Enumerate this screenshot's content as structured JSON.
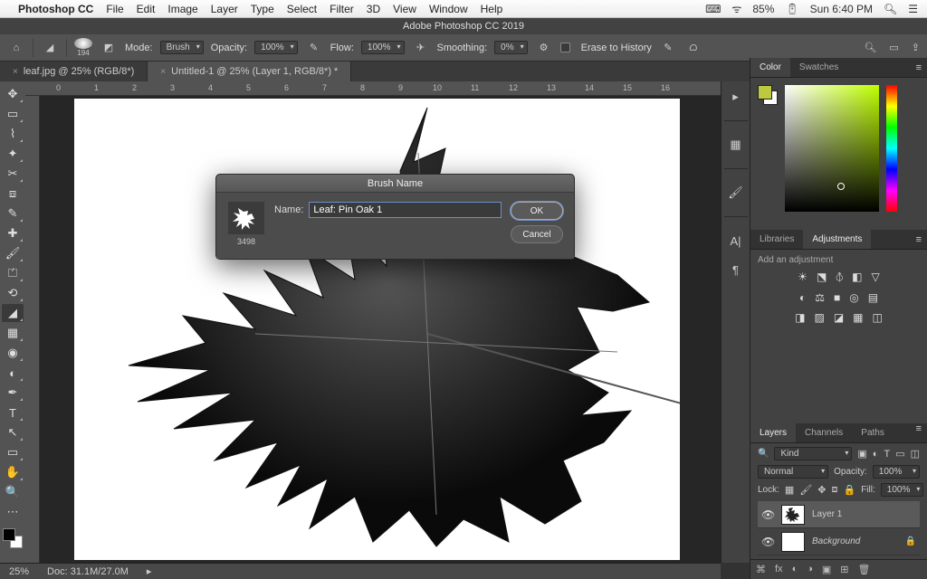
{
  "mac_menu": {
    "app": "Photoshop CC",
    "items": [
      "File",
      "Edit",
      "Image",
      "Layer",
      "Type",
      "Select",
      "Filter",
      "3D",
      "View",
      "Window",
      "Help"
    ],
    "battery": "85%",
    "clock": "Sun 6:40 PM"
  },
  "titlebar": "Adobe Photoshop CC 2019",
  "optbar": {
    "brush_size": "194",
    "mode_label": "Mode:",
    "mode_value": "Brush",
    "opacity_label": "Opacity:",
    "opacity_value": "100%",
    "flow_label": "Flow:",
    "flow_value": "100%",
    "smoothing_label": "Smoothing:",
    "smoothing_value": "0%",
    "erase_history": "Erase to History"
  },
  "tabs": [
    {
      "label": "leaf.jpg @ 25% (RGB/8*)"
    },
    {
      "label": "Untitled-1 @ 25% (Layer 1, RGB/8*) *"
    }
  ],
  "ruler_marks": [
    "0",
    "1",
    "2",
    "3",
    "4",
    "5",
    "6",
    "7",
    "8",
    "9",
    "10",
    "11",
    "12",
    "13",
    "14",
    "15",
    "16"
  ],
  "dialog": {
    "title": "Brush Name",
    "name_label": "Name:",
    "name_value": "Leaf: Pin Oak 1",
    "thumb_size": "3498",
    "ok": "OK",
    "cancel": "Cancel"
  },
  "panels": {
    "color_tab": "Color",
    "swatches_tab": "Swatches",
    "libraries_tab": "Libraries",
    "adjustments_tab": "Adjustments",
    "adj_hint": "Add an adjustment",
    "layers_tab": "Layers",
    "channels_tab": "Channels",
    "paths_tab": "Paths",
    "kind_label": "Kind",
    "blend_mode": "Normal",
    "opacity_label": "Opacity:",
    "opacity_value": "100%",
    "lock_label": "Lock:",
    "fill_label": "Fill:",
    "fill_value": "100%",
    "layer1": "Layer 1",
    "background": "Background"
  },
  "status": {
    "zoom": "25%",
    "doc": "Doc: 31.1M/27.0M"
  }
}
